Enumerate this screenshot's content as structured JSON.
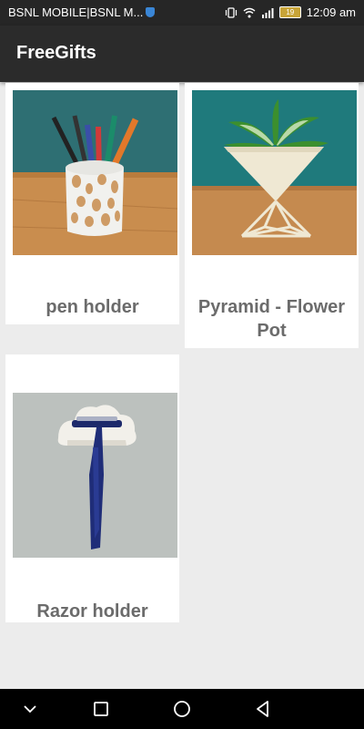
{
  "status_bar": {
    "carrier": "BSNL MOBILE|BSNL M...",
    "battery": "19",
    "time": "12:09 am"
  },
  "app_bar": {
    "title": "FreeGifts"
  },
  "items": [
    {
      "title": "pen holder"
    },
    {
      "title": "Pyramid - Flower Pot"
    },
    {
      "title": "Razor holder"
    }
  ],
  "colors": {
    "app_bar": "#2b2b2b",
    "status_bar": "#262626",
    "background": "#ececec",
    "caption": "#6b6b6b"
  }
}
